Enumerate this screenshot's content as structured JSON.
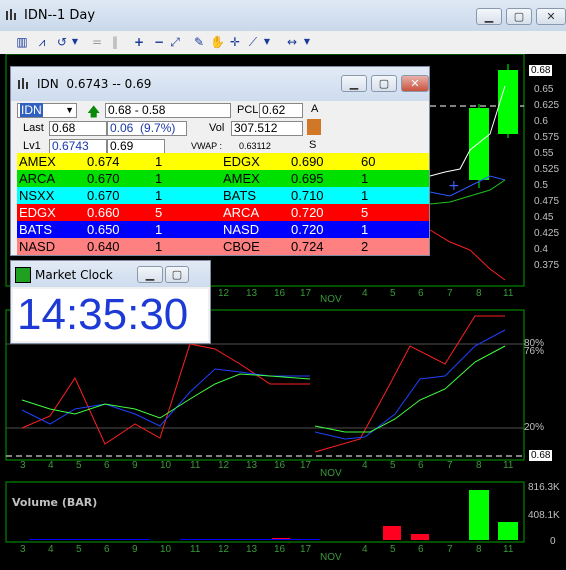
{
  "window": {
    "title": "IDN--1 Day"
  },
  "toolbar": {
    "icons": [
      "bar-chart-icon",
      "line-chart-icon",
      "undo-icon",
      "separator",
      "plus-icon",
      "minus-icon",
      "fit-icon",
      "pencil-icon",
      "hand-icon",
      "crosshair-icon",
      "draw-line-icon",
      "expand-icon"
    ]
  },
  "price_axis": {
    "ticks": [
      "0.65",
      "0.625",
      "0.6",
      "0.575",
      "0.55",
      "0.525",
      "0.5",
      "0.475",
      "0.45",
      "0.425",
      "0.4",
      "0.375"
    ],
    "last_price_tag": "0.68"
  },
  "osc_axis": {
    "ticks": [
      "80%",
      "76%",
      "20%"
    ],
    "tag": "0.68"
  },
  "volume_axis": {
    "ticks": [
      "816.3K",
      "408.1K",
      "0"
    ]
  },
  "volume_label": "Volume (BAR)",
  "x_axis": {
    "labels_top": [
      "12",
      "13",
      "16",
      "17",
      "NOV",
      "4",
      "5",
      "6",
      "7",
      "8",
      "11"
    ],
    "labels_mid": [
      "3",
      "4",
      "5",
      "6",
      "9",
      "10",
      "11",
      "12",
      "13",
      "16",
      "17",
      "NOV",
      "4",
      "5",
      "6",
      "7",
      "8",
      "11"
    ],
    "labels_bot": [
      "3",
      "4",
      "5",
      "6",
      "9",
      "10",
      "11",
      "12",
      "13",
      "16",
      "17",
      "NOV",
      "4",
      "5",
      "6",
      "7",
      "8",
      "11"
    ]
  },
  "level2": {
    "title_symbol": "IDN",
    "title_quote": "0.6743 -- 0.69",
    "symbol": "IDN",
    "range": "0.68 - 0.58",
    "pcl_label": "PCL",
    "pcl": "0.62",
    "a_label": "A",
    "last_label": "Last",
    "last": "0.68",
    "change": "0.06",
    "change_pct": "(9.7%)",
    "vol_label": "Vol",
    "vol": "307.512",
    "lv1_label": "Lv1",
    "bid": "0.6743",
    "ask": "0.69",
    "vwap_label": "VWAP :",
    "vwap": "0.63112",
    "s_label": "S",
    "rows": [
      {
        "bid_mm": "AMEX",
        "bid": "0.674",
        "bid_sz": "1",
        "ask_mm": "EDGX",
        "ask": "0.690",
        "ask_sz": "60",
        "bid_color": "#ffff00",
        "ask_color": "#ffff00",
        "bid_text": "#000000",
        "ask_text": "#000000"
      },
      {
        "bid_mm": "ARCA",
        "bid": "0.670",
        "bid_sz": "1",
        "ask_mm": "AMEX",
        "ask": "0.695",
        "ask_sz": "1",
        "bid_color": "#00e000",
        "ask_color": "#00e000",
        "bid_text": "#000000",
        "ask_text": "#000000"
      },
      {
        "bid_mm": "NSXX",
        "bid": "0.670",
        "bid_sz": "1",
        "ask_mm": "BATS",
        "ask": "0.710",
        "ask_sz": "1",
        "bid_color": "#00ffff",
        "ask_color": "#00ffff",
        "bid_text": "#000000",
        "ask_text": "#000000"
      },
      {
        "bid_mm": "EDGX",
        "bid": "0.660",
        "bid_sz": "5",
        "ask_mm": "ARCA",
        "ask": "0.720",
        "ask_sz": "5",
        "bid_color": "#ff0000",
        "ask_color": "#ff0000",
        "bid_text": "#ffffff",
        "ask_text": "#ffffff"
      },
      {
        "bid_mm": "BATS",
        "bid": "0.650",
        "bid_sz": "1",
        "ask_mm": "NASD",
        "ask": "0.720",
        "ask_sz": "1",
        "bid_color": "#0000ff",
        "ask_color": "#0000ff",
        "bid_text": "#ffffff",
        "ask_text": "#ffffff"
      },
      {
        "bid_mm": "NASD",
        "bid": "0.640",
        "bid_sz": "1",
        "ask_mm": "CBOE",
        "ask": "0.724",
        "ask_sz": "2",
        "bid_color": "#ff8080",
        "ask_color": "#ff8080",
        "bid_text": "#000000",
        "ask_text": "#000000"
      }
    ]
  },
  "clock": {
    "title": "Market Clock",
    "time": "14:35:30"
  },
  "colors": {
    "up_candle": "#00ff00",
    "osc_red": "#ff2020",
    "osc_blue": "#2040ff",
    "osc_green": "#40ff40"
  }
}
